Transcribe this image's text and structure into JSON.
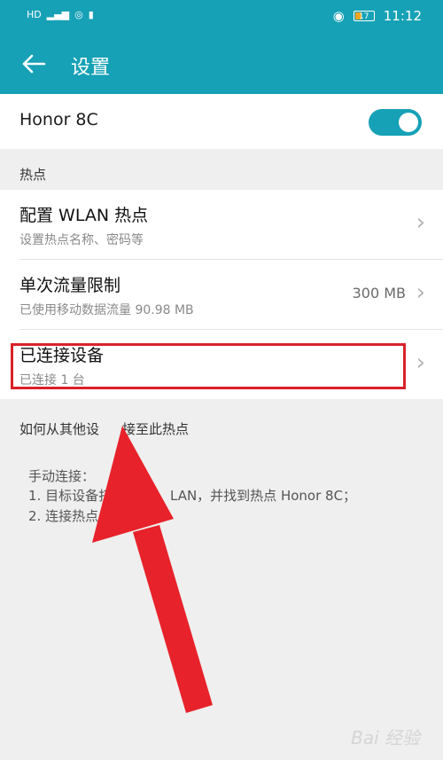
{
  "status_bar": {
    "left_icons": [
      "hd-icon",
      "4g-signal-icon",
      "hotspot-icon",
      "notification-icon"
    ],
    "battery": "17",
    "time": "11:12"
  },
  "app_bar": {
    "title": "设置"
  },
  "master": {
    "label": "Honor 8C",
    "toggle_on": true
  },
  "hotspot_section": {
    "header": "热点",
    "items": [
      {
        "title": "配置 WLAN 热点",
        "subtitle": "设置热点名称、密码等",
        "value": ""
      },
      {
        "title": "单次流量限制",
        "subtitle": "已使用移动数据流量 90.98 MB",
        "value": "300 MB"
      },
      {
        "title": "已连接设备",
        "subtitle": "已连接 1 台",
        "value": ""
      }
    ]
  },
  "instructions": {
    "header": "如何从其他设",
    "header_tail": "接至此热点",
    "lines": [
      "手动连接：",
      "1. 目标设备打",
      "LAN，并找到热点 Honor 8C；",
      "2. 连接热点。"
    ]
  },
  "colors": {
    "accent": "#16a1b6",
    "highlight": "#d9222a",
    "arrow": "#e8222a"
  },
  "watermark": "Bai 经验"
}
